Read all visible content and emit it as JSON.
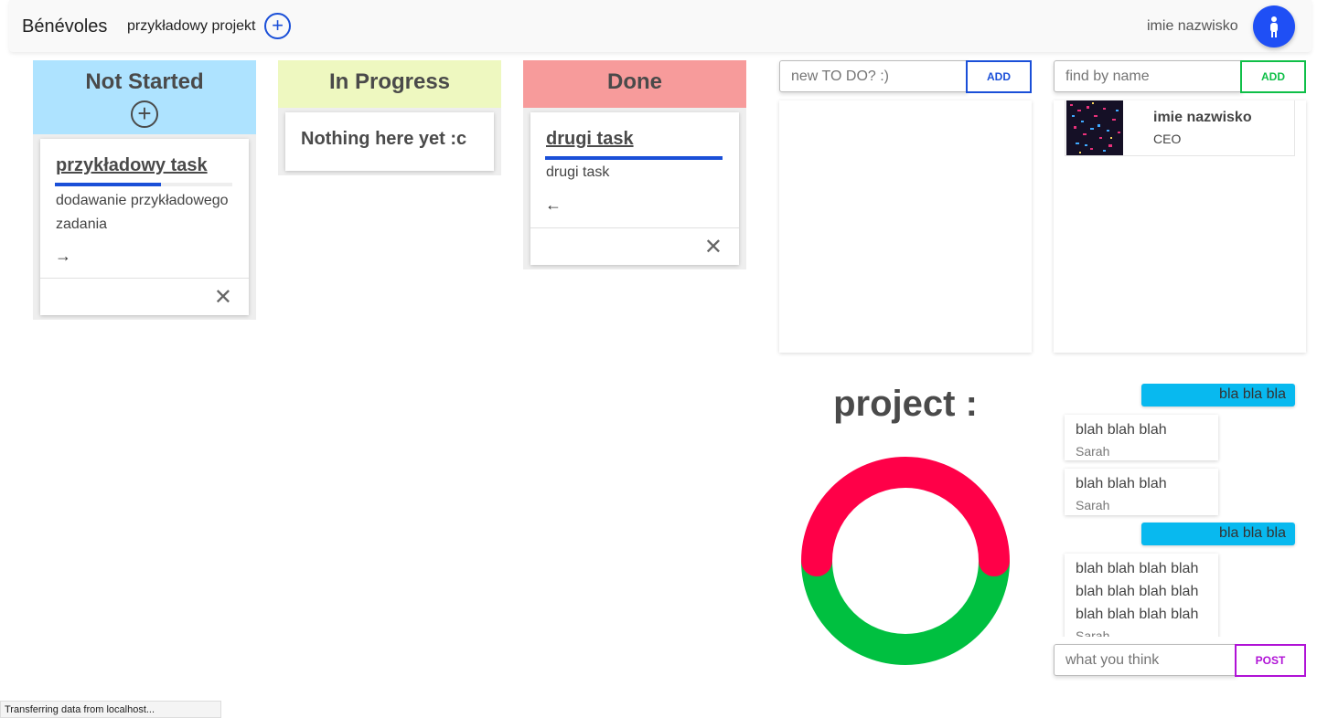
{
  "navbar": {
    "brand": "Bénévoles",
    "project_name": "przykładowy projekt",
    "add_project_icon": "plus-circle-icon",
    "user_name": "imie nazwisko",
    "user_icon": "person-icon"
  },
  "columns": {
    "not_started": {
      "title": "Not Started",
      "cards": [
        {
          "title": "przykładowy task",
          "progress": 0.6,
          "description": "dodawanie przykładowego zadania",
          "arrow": "→",
          "close": "✕"
        }
      ]
    },
    "in_progress": {
      "title": "In Progress",
      "empty_text": "Nothing here yet :c"
    },
    "done": {
      "title": "Done",
      "cards": [
        {
          "title": "drugi task",
          "progress": 1.0,
          "description": "drugi task",
          "arrow": "←",
          "close": "✕"
        }
      ]
    }
  },
  "todo": {
    "placeholder": "new TO DO? :)",
    "add_label": "ADD"
  },
  "members": {
    "placeholder": "find by name",
    "add_label": "ADD",
    "list": [
      {
        "name": "imie nazwisko",
        "role": "CEO"
      }
    ]
  },
  "project": {
    "title": "project :"
  },
  "chart_data": {
    "type": "pie",
    "categories": [
      "red",
      "green"
    ],
    "values": [
      50,
      50
    ],
    "colors": [
      "#ff0048",
      "#00c040"
    ],
    "title": ""
  },
  "chat": {
    "messages": [
      {
        "mine": true,
        "text": "bla bla bla"
      },
      {
        "mine": false,
        "text": "blah blah blah",
        "author": "Sarah"
      },
      {
        "mine": false,
        "text": "blah blah blah",
        "author": "Sarah"
      },
      {
        "mine": true,
        "text": "bla bla bla"
      },
      {
        "mine": false,
        "text": "blah blah blah blah blah blah blah blah blah blah blah blah",
        "author": "Sarah"
      }
    ],
    "placeholder": "what you think",
    "post_label": "POST"
  },
  "status_bar": {
    "text": "Transferring data from localhost..."
  }
}
